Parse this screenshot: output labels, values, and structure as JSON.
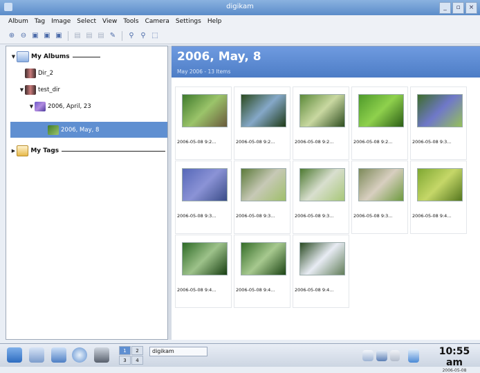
{
  "window": {
    "title": "digikam",
    "buttons": [
      "_",
      "▫",
      "×"
    ]
  },
  "menu": [
    "Album",
    "Tag",
    "Image",
    "Select",
    "View",
    "Tools",
    "Camera",
    "Settings",
    "Help"
  ],
  "toolbar": {
    "icons": [
      {
        "name": "zoom-in-icon",
        "glyph": "⊕",
        "enabled": true
      },
      {
        "name": "zoom-out-icon",
        "glyph": "⊖",
        "enabled": true
      },
      {
        "name": "album-new-icon",
        "glyph": "▣",
        "enabled": true
      },
      {
        "name": "album-props-icon",
        "glyph": "▣",
        "enabled": true
      },
      {
        "name": "album-delete-icon",
        "glyph": "▣",
        "enabled": true
      },
      {
        "name": "sep1"
      },
      {
        "name": "image-view-icon",
        "glyph": "▤",
        "enabled": false
      },
      {
        "name": "image-edit-icon",
        "glyph": "▤",
        "enabled": false
      },
      {
        "name": "image-rename-icon",
        "glyph": "▤",
        "enabled": false
      },
      {
        "name": "pencil-icon",
        "glyph": "✎",
        "enabled": true
      },
      {
        "name": "sep2"
      },
      {
        "name": "thumb-larger-icon",
        "glyph": "⚲",
        "enabled": true
      },
      {
        "name": "thumb-smaller-icon",
        "glyph": "⚲",
        "enabled": true
      },
      {
        "name": "fullscreen-icon",
        "glyph": "⬚",
        "enabled": true
      }
    ]
  },
  "sidebar": {
    "albums_label": "My Albums",
    "tags_label": "My Tags",
    "items": [
      {
        "label": "Dir_2"
      },
      {
        "label": "test_dir"
      },
      {
        "label": "2006, April, 23"
      },
      {
        "label": "2006, May, 8"
      }
    ]
  },
  "main": {
    "title": "2006, May, 8",
    "subtitle": "May 2006 - 13 Items",
    "thumbnails": [
      {
        "caption": "2006-05-08 9:2...",
        "colors": [
          "#3f7a2c",
          "#9bc46a",
          "#6a5a3c"
        ]
      },
      {
        "caption": "2006-05-08 9:2...",
        "colors": [
          "#2c4a1e",
          "#85a8c8",
          "#1f3a16"
        ]
      },
      {
        "caption": "2006-05-08 9:2...",
        "colors": [
          "#5d8a3a",
          "#c9d8a1",
          "#2e4d1f"
        ]
      },
      {
        "caption": "2006-05-08 9:2...",
        "colors": [
          "#4e9a2a",
          "#8fd14d",
          "#2c5e16"
        ]
      },
      {
        "caption": "2006-05-08 9:3...",
        "colors": [
          "#3e6d2b",
          "#6f78c9",
          "#96c15a"
        ]
      },
      {
        "caption": "2006-05-08 9:3...",
        "colors": [
          "#5668b8",
          "#8b93d6",
          "#3a4c88"
        ]
      },
      {
        "caption": "2006-05-08 9:3...",
        "colors": [
          "#5c7a3a",
          "#c7c9b6",
          "#9fbf6a"
        ]
      },
      {
        "caption": "2006-05-08 9:3...",
        "colors": [
          "#4d7a31",
          "#d9dfcf",
          "#a7c778"
        ]
      },
      {
        "caption": "2006-05-08 9:3...",
        "colors": [
          "#7d8a5a",
          "#d8cfc0",
          "#6e9a3f"
        ]
      },
      {
        "caption": "2006-05-08 9:4...",
        "colors": [
          "#7fa832",
          "#c5d768",
          "#55771f"
        ]
      },
      {
        "caption": "2006-05-08 9:4...",
        "colors": [
          "#2e6a26",
          "#9dc28a",
          "#183f12"
        ]
      },
      {
        "caption": "2006-05-08 9:4...",
        "colors": [
          "#356d28",
          "#a7c98f",
          "#1c4414"
        ]
      },
      {
        "caption": "2006-05-08 9:4...",
        "colors": [
          "#2a4a22",
          "#e8ecf4",
          "#617d58"
        ]
      }
    ]
  },
  "taskbar": {
    "desktops": [
      "1",
      "2",
      "3",
      "4"
    ],
    "active_desktop": "1",
    "task_label": "digikam",
    "clock_time": "10:55 am",
    "clock_date": "2006-05-08"
  }
}
